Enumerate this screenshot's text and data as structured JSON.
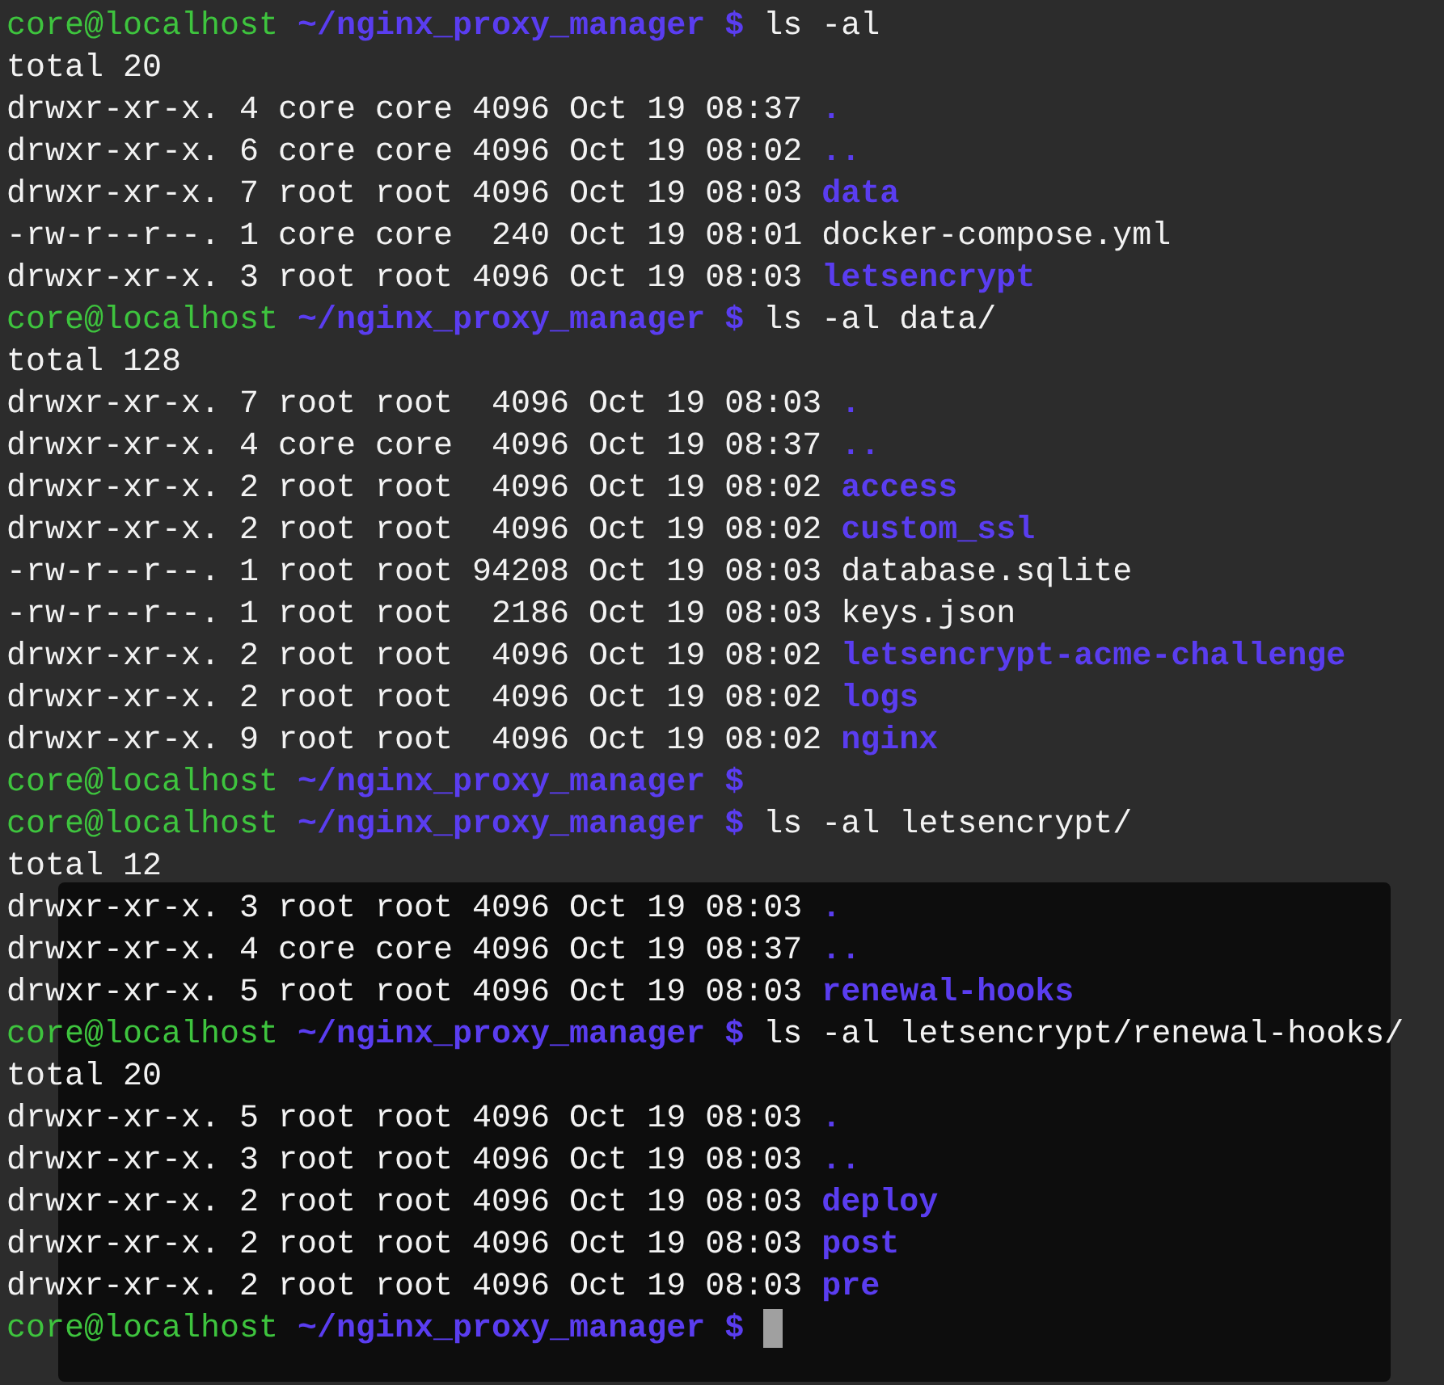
{
  "terminal": {
    "lines": [
      {
        "kind": "prompt",
        "user": "core@localhost",
        "path": "~/nginx_proxy_manager $",
        "command": "ls -al",
        "cursor": false
      },
      {
        "kind": "output",
        "text": "total 20"
      },
      {
        "kind": "dir",
        "meta": "drwxr-xr-x. 4 core core 4096 Oct 19 08:37",
        "name": "."
      },
      {
        "kind": "dir",
        "meta": "drwxr-xr-x. 6 core core 4096 Oct 19 08:02",
        "name": ".."
      },
      {
        "kind": "dir",
        "meta": "drwxr-xr-x. 7 root root 4096 Oct 19 08:03",
        "name": "data"
      },
      {
        "kind": "file",
        "meta": "-rw-r--r--. 1 core core  240 Oct 19 08:01",
        "name": "docker-compose.yml"
      },
      {
        "kind": "dir",
        "meta": "drwxr-xr-x. 3 root root 4096 Oct 19 08:03",
        "name": "letsencrypt"
      },
      {
        "kind": "prompt",
        "user": "core@localhost",
        "path": "~/nginx_proxy_manager $",
        "command": "ls -al data/",
        "cursor": false
      },
      {
        "kind": "output",
        "text": "total 128"
      },
      {
        "kind": "dir",
        "meta": "drwxr-xr-x. 7 root root  4096 Oct 19 08:03",
        "name": "."
      },
      {
        "kind": "dir",
        "meta": "drwxr-xr-x. 4 core core  4096 Oct 19 08:37",
        "name": ".."
      },
      {
        "kind": "dir",
        "meta": "drwxr-xr-x. 2 root root  4096 Oct 19 08:02",
        "name": "access"
      },
      {
        "kind": "dir",
        "meta": "drwxr-xr-x. 2 root root  4096 Oct 19 08:02",
        "name": "custom_ssl"
      },
      {
        "kind": "file",
        "meta": "-rw-r--r--. 1 root root 94208 Oct 19 08:03",
        "name": "database.sqlite"
      },
      {
        "kind": "file",
        "meta": "-rw-r--r--. 1 root root  2186 Oct 19 08:03",
        "name": "keys.json"
      },
      {
        "kind": "dir",
        "meta": "drwxr-xr-x. 2 root root  4096 Oct 19 08:02",
        "name": "letsencrypt-acme-challenge"
      },
      {
        "kind": "dir",
        "meta": "drwxr-xr-x. 2 root root  4096 Oct 19 08:02",
        "name": "logs"
      },
      {
        "kind": "dir",
        "meta": "drwxr-xr-x. 9 root root  4096 Oct 19 08:02",
        "name": "nginx"
      },
      {
        "kind": "prompt",
        "user": "core@localhost",
        "path": "~/nginx_proxy_manager $",
        "cursor": false
      },
      {
        "kind": "prompt",
        "user": "core@localhost",
        "path": "~/nginx_proxy_manager $",
        "command": "ls -al letsencrypt/",
        "cursor": false
      },
      {
        "kind": "output",
        "text": "total 12"
      },
      {
        "kind": "dir",
        "meta": "drwxr-xr-x. 3 root root 4096 Oct 19 08:03",
        "name": "."
      },
      {
        "kind": "dir",
        "meta": "drwxr-xr-x. 4 core core 4096 Oct 19 08:37",
        "name": ".."
      },
      {
        "kind": "dir",
        "meta": "drwxr-xr-x. 5 root root 4096 Oct 19 08:03",
        "name": "renewal-hooks"
      },
      {
        "kind": "prompt",
        "user": "core@localhost",
        "path": "~/nginx_proxy_manager $",
        "command": "ls -al letsencrypt/renewal-hooks/",
        "cursor": false
      },
      {
        "kind": "output",
        "text": "total 20"
      },
      {
        "kind": "dir",
        "meta": "drwxr-xr-x. 5 root root 4096 Oct 19 08:03",
        "name": "."
      },
      {
        "kind": "dir",
        "meta": "drwxr-xr-x. 3 root root 4096 Oct 19 08:03",
        "name": ".."
      },
      {
        "kind": "dir",
        "meta": "drwxr-xr-x. 2 root root 4096 Oct 19 08:03",
        "name": "deploy"
      },
      {
        "kind": "dir",
        "meta": "drwxr-xr-x. 2 root root 4096 Oct 19 08:03",
        "name": "post"
      },
      {
        "kind": "dir",
        "meta": "drwxr-xr-x. 2 root root 4096 Oct 19 08:03",
        "name": "pre"
      },
      {
        "kind": "prompt",
        "user": "core@localhost",
        "path": "~/nginx_proxy_manager $",
        "cursor": true
      }
    ]
  }
}
